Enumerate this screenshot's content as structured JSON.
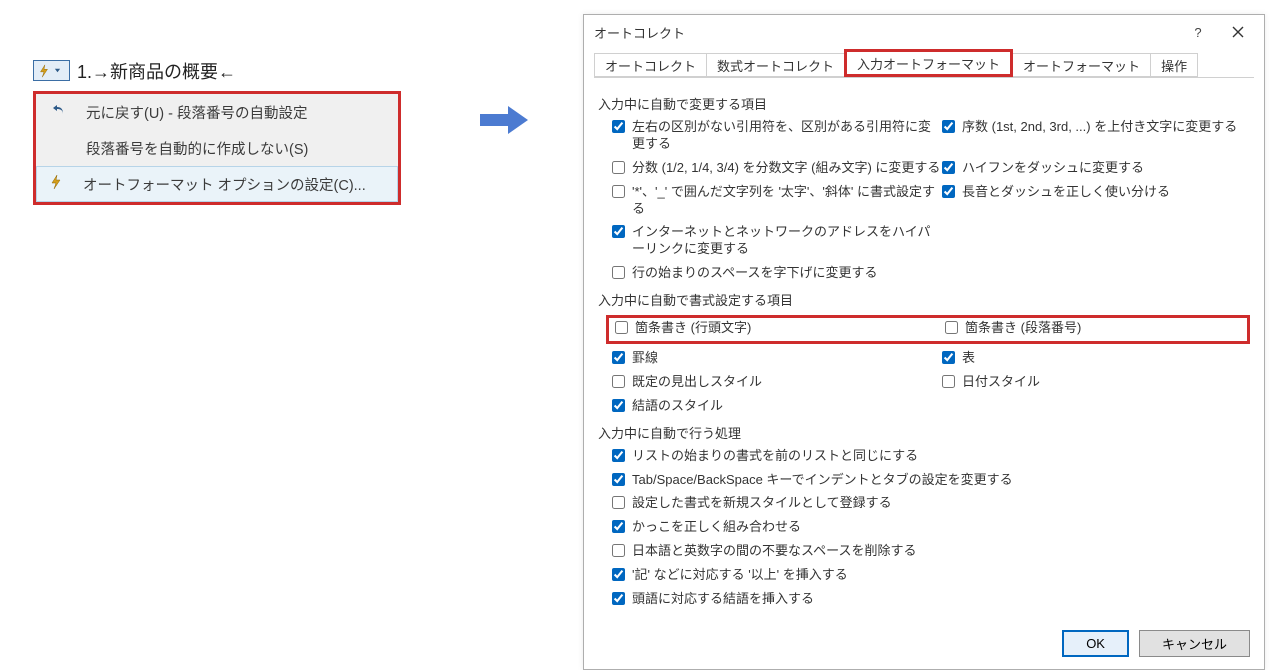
{
  "doc": {
    "title_line": "1.→新商品の概要←"
  },
  "word_menu": {
    "undo": "元に戻す(U) - 段落番号の自動設定",
    "stop": "段落番号を自動的に作成しない(S)",
    "options": "オートフォーマット オプションの設定(C)..."
  },
  "dialog": {
    "title": "オートコレクト",
    "tabs": {
      "t1": "オートコレクト",
      "t2": "数式オートコレクト",
      "t3": "入力オートフォーマット",
      "t4": "オートフォーマット",
      "t5": "操作"
    },
    "sec1_title": "入力中に自動で変更する項目",
    "sec2_title": "入力中に自動で書式設定する項目",
    "sec3_title": "入力中に自動で行う処理",
    "sec1": {
      "c1": "左右の区別がない引用符を、区別がある引用符に変更する",
      "c2": "分数 (1/2, 1/4, 3/4) を分数文字 (組み文字) に変更する",
      "c3": "'*'、'_' で囲んだ文字列を '太字'、'斜体' に書式設定する",
      "c4": "インターネットとネットワークのアドレスをハイパーリンクに変更する",
      "c5": "行の始まりのスペースを字下げに変更する",
      "r1": "序数 (1st, 2nd, 3rd, ...) を上付き文字に変更する",
      "r2": "ハイフンをダッシュに変更する",
      "r3": "長音とダッシュを正しく使い分ける"
    },
    "sec2": {
      "top_left": "箇条書き (行頭文字)",
      "top_right": "箇条書き (段落番号)",
      "a1": "罫線",
      "a2": "既定の見出しスタイル",
      "a3": "結語のスタイル",
      "b1": "表",
      "b2": "日付スタイル"
    },
    "sec3": {
      "p1": "リストの始まりの書式を前のリストと同じにする",
      "p2": "Tab/Space/BackSpace キーでインデントとタブの設定を変更する",
      "p3": "設定した書式を新規スタイルとして登録する",
      "p4": "かっこを正しく組み合わせる",
      "p5": "日本語と英数字の間の不要なスペースを削除する",
      "p6": "'記' などに対応する '以上' を挿入する",
      "p7": "頭語に対応する結語を挿入する"
    },
    "buttons": {
      "ok": "OK",
      "cancel": "キャンセル"
    }
  }
}
